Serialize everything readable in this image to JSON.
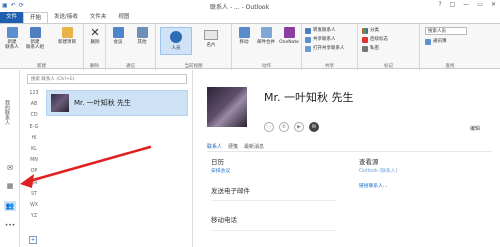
{
  "qat": {
    "icons": [
      "save-icon",
      "undo-icon",
      "sync-icon"
    ]
  },
  "window": {
    "title": "联系人 - ... - Outlook",
    "controls": [
      "?",
      "□",
      "—",
      "▭",
      "✕"
    ]
  },
  "tabs": [
    "文件",
    "开始",
    "发送/接收",
    "文件夹",
    "视图"
  ],
  "ribbon": {
    "new_contact": "新建\n联系人",
    "new_group": "新建\n联系人组",
    "new_items": "新建项目",
    "group_new": "新建",
    "delete": "删除",
    "group_delete": "删除",
    "meeting": "会议",
    "more": "其他",
    "group_comm": "通信",
    "view_people": "人员",
    "view_card": "名片",
    "group_view": "当前视图",
    "move": "移动",
    "mail_merge": "邮件合并",
    "onenote": "OneNote",
    "group_actions": "动作",
    "forward_contact": "转发联系人",
    "share_contact": "共享联系人",
    "open_shared": "打开共享联系人",
    "group_share": "共享",
    "categorize": "分类",
    "followup": "后续标志",
    "private": "私密",
    "group_tags": "标记",
    "search_people": "搜索人员",
    "address_book": "通讯簿",
    "group_find": "查找"
  },
  "leftnav": {
    "label": "我的联系人"
  },
  "list": {
    "search_placeholder": "搜索 联系人 (Ctrl+E)",
    "letters": [
      "123",
      "AB",
      "CD",
      "E-G",
      "HI",
      "KL",
      "MN",
      "OP",
      "QR",
      "ST",
      "WX",
      "YZ"
    ],
    "contact_name": "Mr. 一叶知秋 先生"
  },
  "detail": {
    "name": "Mr. 一叶知秋 先生",
    "edit": "编辑",
    "subtabs": [
      "联系人",
      "便笺",
      "最新消息"
    ],
    "calendar_label": "日历",
    "calendar_value": "安排会议",
    "viewsource_label": "查看源",
    "viewsource_value": "Outlook (联系人)",
    "link_contacts": "链接联系人...",
    "email_label": "发送电子邮件",
    "mobile_label": "移动电话"
  },
  "colors": {
    "accent": "#1f5fb0",
    "selection": "#cde3f5",
    "arrow": "#e02020"
  }
}
